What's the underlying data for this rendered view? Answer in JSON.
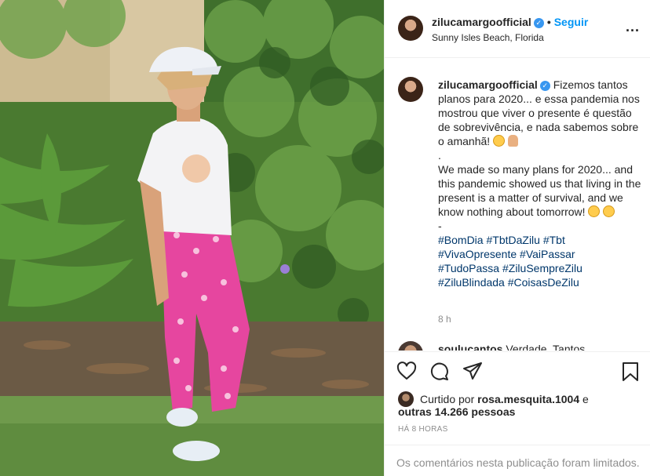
{
  "header": {
    "username": "zilucamargoofficial",
    "separator": "•",
    "follow_label": "Seguir",
    "location": "Sunny Isles Beach, Florida",
    "more_label": "..."
  },
  "caption": {
    "username": "zilucamargoofficial",
    "text_pt": "Fizemos tantos planos para 2020... e essa pandemia nos mostrou que viver o presente é questão de sobrevivência, e nada sabemos sobre o amanhã!",
    "dot1": ".",
    "text_en": "We made so many plans for 2020... and this pandemic showed us that living in the present is a matter of survival, and we know nothing about tomorrow!",
    "dash": "-",
    "hashtags": [
      "#BomDia",
      "#TbtDaZilu",
      "#Tbt",
      "#VivaOpresente",
      "#VaiPassar",
      "#TudoPassa",
      "#ZiluSempreZilu",
      "#ZiluBlindada",
      "#CoisasDeZilu"
    ],
    "time": "8 h"
  },
  "second_comment": {
    "username": "soulucantos",
    "text": "Verdade. Tantos"
  },
  "likes": {
    "prefix": "Curtido por",
    "user": "rosa.mesquita.1004",
    "conj": "e",
    "others": "outras 14.266 pessoas"
  },
  "timestamp": "HÁ 8 HORAS",
  "comments_limited": "Os comentários nesta publicação foram limitados.",
  "colors": {
    "accent": "#0095f6",
    "verified": "#3897f0",
    "hashtag": "#00376b",
    "muted": "#8e8e8e",
    "border": "#efefef"
  },
  "icons": [
    "verified-icon",
    "more-icon",
    "heart-icon",
    "comment-icon",
    "share-icon",
    "save-icon"
  ]
}
